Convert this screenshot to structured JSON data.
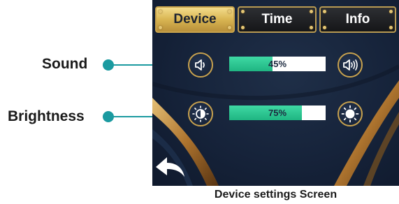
{
  "tabs": [
    {
      "label": "Device",
      "active": true
    },
    {
      "label": "Time",
      "active": false
    },
    {
      "label": "Info",
      "active": false
    }
  ],
  "sound": {
    "label": "Sound",
    "value_text": "45%",
    "level": 0.45,
    "decrease_icon": "speaker-low-icon",
    "increase_icon": "speaker-high-icon"
  },
  "brightness": {
    "label": "Brightness",
    "value_text": "75%",
    "level": 0.75,
    "decrease_icon": "brightness-low-icon",
    "increase_icon": "brightness-high-icon"
  },
  "back_icon": "back-arrow-icon",
  "caption": "Device settings Screen",
  "colors": {
    "accent_gold": "#c9a44c",
    "bar_fill": "#1fb582",
    "callout": "#1b9aa0",
    "screen_bg": "#16233a"
  }
}
